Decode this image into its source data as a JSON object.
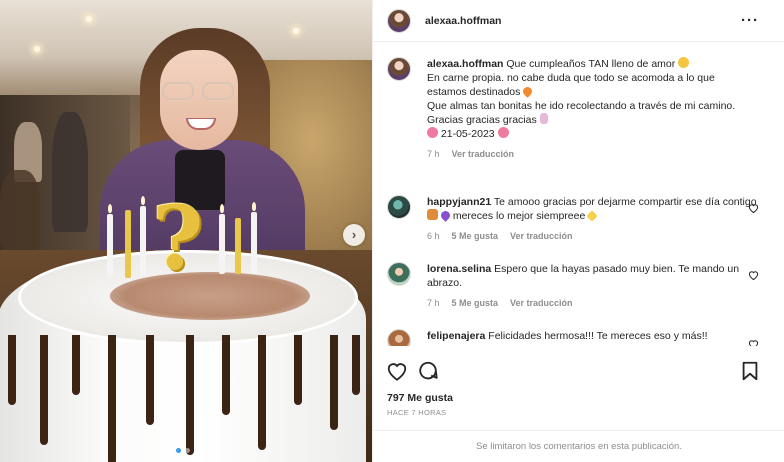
{
  "post": {
    "author": "alexaa.hoffman",
    "more_icon": "more-horizontal-icon"
  },
  "caption": {
    "author": "alexaa.hoffman",
    "line1": "Que cumpleaños TAN lleno de amor",
    "line2": "En carne propia. no cabe duda que todo se acomoda a lo que estamos destinados",
    "line3": "Que almas tan bonitas he ido recolectando a través de mi camino.",
    "line4": "Gracias gracias gracias",
    "date": "21-05-2023",
    "time": "7 h",
    "translate": "Ver traducción"
  },
  "comments": [
    {
      "author": "happyjann21",
      "text1": "Te amooo gracias por dejarme compartir ese día contigo",
      "text2": "mereces lo mejor siempreee",
      "time": "6 h",
      "likes": "5 Me gusta",
      "translate": "Ver traducción"
    },
    {
      "author": "lorena.selina",
      "text": "Espero que la hayas pasado muy bien. Te mando un abrazo.",
      "time": "7 h",
      "likes": "5 Me gusta",
      "translate": "Ver traducción"
    },
    {
      "author": "felipenajera",
      "text": "Felicidades hermosa!!! Te mereces eso y más!!"
    }
  ],
  "actions": {
    "like_icon": "heart-icon",
    "comment_icon": "comment-icon",
    "save_icon": "bookmark-icon"
  },
  "likes_count": "797 Me gusta",
  "posted_ago": "HACE 7 HORAS",
  "comments_limited": "Se limitaron los comentarios en esta publicación.",
  "colors": {
    "text": "#262626",
    "secondary": "#8e8e8e",
    "border": "#efefef",
    "carousel_active": "#3b9bf0"
  }
}
